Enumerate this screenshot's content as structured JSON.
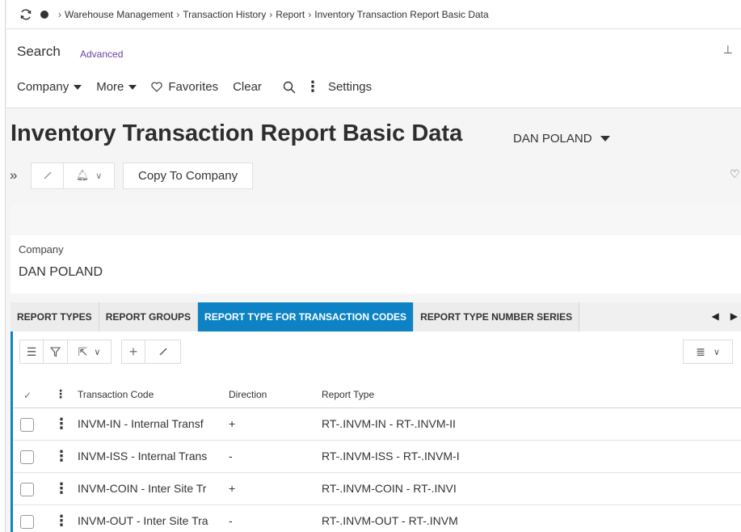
{
  "breadcrumb": [
    "Warehouse Management",
    "Transaction History",
    "Report",
    "Inventory Transaction Report Basic Data"
  ],
  "search": {
    "title": "Search",
    "advanced": "Advanced",
    "menu": {
      "company": "Company",
      "more": "More",
      "favorites": "Favorites",
      "clear": "Clear",
      "settings": "Settings"
    }
  },
  "page": {
    "title": "Inventory Transaction Report Basic Data",
    "company_selector": "DAN POLAND"
  },
  "toolbar": {
    "copy_to_company": "Copy To Company"
  },
  "company_card": {
    "label": "Company",
    "value": "DAN POLAND"
  },
  "tabs": [
    {
      "label": "REPORT TYPES",
      "active": false
    },
    {
      "label": "REPORT GROUPS",
      "active": false
    },
    {
      "label": "REPORT TYPE FOR TRANSACTION CODES",
      "active": true
    },
    {
      "label": "REPORT TYPE NUMBER SERIES",
      "active": false
    }
  ],
  "grid": {
    "columns": {
      "transaction_code": "Transaction Code",
      "direction": "Direction",
      "report_type": "Report Type"
    },
    "rows": [
      {
        "transaction_code": "INVM-IN - Internal Transf",
        "direction": "+",
        "report_type": "RT-.INVM-IN - RT-.INVM-II"
      },
      {
        "transaction_code": "INVM-ISS - Internal Trans",
        "direction": "-",
        "report_type": "RT-.INVM-ISS - RT-.INVM-I"
      },
      {
        "transaction_code": "INVM-COIN - Inter Site Tr",
        "direction": "+",
        "report_type": "RT-.INVM-COIN - RT-.INVI"
      },
      {
        "transaction_code": "INVM-OUT - Inter Site Tra",
        "direction": "-",
        "report_type": "RT-.INVM-OUT - RT-.INVM"
      }
    ]
  },
  "colors": {
    "accent": "#0d83c6",
    "advanced_link": "#6b3fa0"
  }
}
